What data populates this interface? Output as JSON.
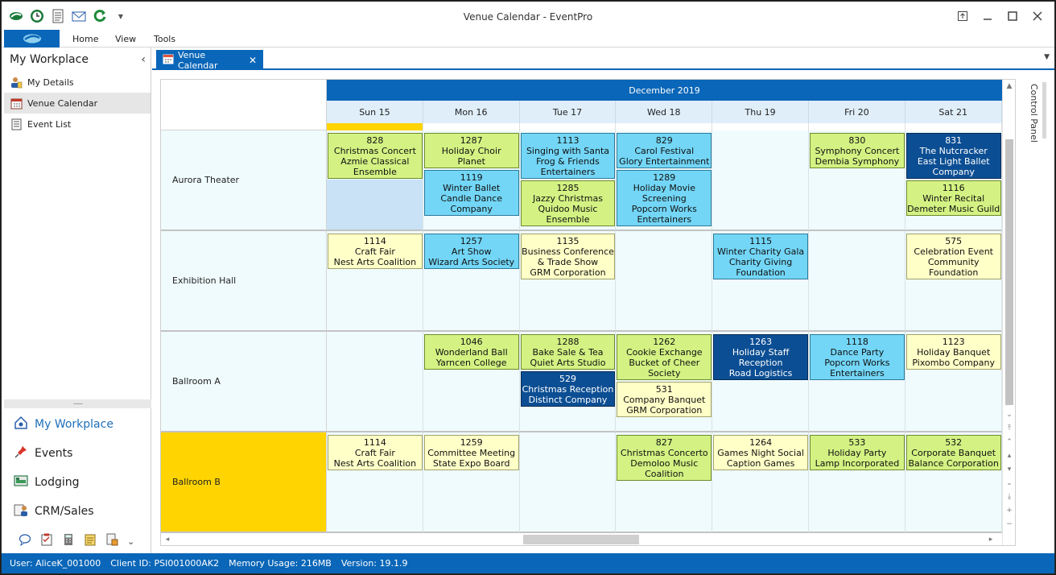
{
  "window": {
    "title": "Venue Calendar - EventPro"
  },
  "ribbon": {
    "tabs": [
      "Home",
      "View",
      "Tools"
    ]
  },
  "sidebar": {
    "title": "My Workplace",
    "items": [
      {
        "label": "My Details",
        "icon": "user-details-icon"
      },
      {
        "label": "Venue Calendar",
        "icon": "calendar-icon"
      },
      {
        "label": "Event List",
        "icon": "document-list-icon"
      }
    ],
    "grip": "......",
    "nav": [
      {
        "label": "My Workplace",
        "icon": "home-icon"
      },
      {
        "label": "Events",
        "icon": "pin-icon"
      },
      {
        "label": "Lodging",
        "icon": "lodging-icon"
      },
      {
        "label": "CRM/Sales",
        "icon": "crm-icon"
      }
    ]
  },
  "doc_tab": {
    "label": "Venue Calendar"
  },
  "calendar": {
    "month": "December 2019",
    "days": [
      "Sun 15",
      "Mon 16",
      "Tue 17",
      "Wed 18",
      "Thu 19",
      "Fri 20",
      "Sat 21"
    ],
    "resources": [
      "Aurora Theater",
      "Exhibition Hall",
      "Ballroom A",
      "Ballroom B"
    ],
    "events": [
      {
        "res": 0,
        "day": 0,
        "slot": 0,
        "span": 2,
        "color": "g",
        "lines": [
          "828",
          "Christmas Concert",
          "Azmie Classical",
          "Ensemble"
        ]
      },
      {
        "res": 0,
        "day": 1,
        "slot": 0,
        "span": 1,
        "color": "g",
        "lines": [
          "1287",
          "Holiday Choir",
          "Planet Entertainment"
        ]
      },
      {
        "res": 0,
        "day": 1,
        "slot": 1,
        "span": 2,
        "color": "c",
        "lines": [
          "1119",
          "Winter Ballet",
          "Candle Dance",
          "Company"
        ]
      },
      {
        "res": 0,
        "day": 2,
        "slot": 0,
        "span": 2,
        "color": "c",
        "lines": [
          "1113",
          "Singing with Santa",
          "Frog & Friends",
          "Entertainers"
        ]
      },
      {
        "res": 0,
        "day": 2,
        "slot": 2,
        "span": 2,
        "color": "g",
        "lines": [
          "1285",
          "Jazzy Christmas",
          "Quidoo Music",
          "Ensemble"
        ]
      },
      {
        "res": 0,
        "day": 3,
        "slot": 0,
        "span": 1,
        "color": "c",
        "lines": [
          "829",
          "Carol Festival",
          "Glory Entertainment"
        ]
      },
      {
        "res": 0,
        "day": 3,
        "slot": 1,
        "span": 3,
        "color": "c",
        "lines": [
          "1289",
          "Holiday Movie",
          "Screening",
          "Popcorn Works",
          "Entertainers"
        ]
      },
      {
        "res": 0,
        "day": 5,
        "slot": 0,
        "span": 1,
        "color": "g",
        "lines": [
          "830",
          "Symphony Concert",
          "Dembia Symphony"
        ]
      },
      {
        "res": 0,
        "day": 6,
        "slot": 0,
        "span": 2,
        "color": "b",
        "lines": [
          "831",
          "The Nutcracker",
          "East Light Ballet",
          "Company"
        ]
      },
      {
        "res": 0,
        "day": 6,
        "slot": 2,
        "span": 1,
        "color": "g",
        "lines": [
          "1116",
          "Winter Recital",
          "Demeter Music Guild"
        ]
      },
      {
        "res": 1,
        "day": 0,
        "slot": 0,
        "span": 1,
        "color": "y",
        "lines": [
          "1114",
          "Craft Fair",
          "Nest Arts Coalition"
        ]
      },
      {
        "res": 1,
        "day": 1,
        "slot": 0,
        "span": 1,
        "color": "c",
        "lines": [
          "1257",
          "Art Show",
          "Wizard Arts Society"
        ]
      },
      {
        "res": 1,
        "day": 2,
        "slot": 0,
        "span": 2,
        "color": "y",
        "lines": [
          "1135",
          "Business Conference",
          "& Trade Show",
          "GRM Corporation"
        ]
      },
      {
        "res": 1,
        "day": 4,
        "slot": 0,
        "span": 2,
        "color": "c",
        "lines": [
          "1115",
          "Winter Charity Gala",
          "Charity Giving",
          "Foundation"
        ]
      },
      {
        "res": 1,
        "day": 6,
        "slot": 0,
        "span": 2,
        "color": "y",
        "lines": [
          "575",
          "Celebration Event",
          "Community",
          "Foundation"
        ]
      },
      {
        "res": 2,
        "day": 1,
        "slot": 0,
        "span": 1,
        "color": "g",
        "lines": [
          "1046",
          "Wonderland Ball",
          "Yarncen College"
        ]
      },
      {
        "res": 2,
        "day": 2,
        "slot": 0,
        "span": 1,
        "color": "g",
        "lines": [
          "1288",
          "Bake Sale & Tea",
          "Quiet Arts Studio"
        ]
      },
      {
        "res": 2,
        "day": 2,
        "slot": 1,
        "span": 1,
        "color": "b",
        "lines": [
          "529",
          "Christmas Reception",
          "Distinct Company"
        ]
      },
      {
        "res": 2,
        "day": 3,
        "slot": 0,
        "span": 2,
        "color": "g",
        "lines": [
          "1262",
          "Cookie Exchange",
          "Bucket of Cheer",
          "Society"
        ]
      },
      {
        "res": 2,
        "day": 3,
        "slot": 2,
        "span": 1,
        "color": "y",
        "lines": [
          "531",
          "Company Banquet",
          "GRM Corporation"
        ]
      },
      {
        "res": 2,
        "day": 4,
        "slot": 0,
        "span": 2,
        "color": "b",
        "lines": [
          "1263",
          "Holiday Staff",
          "Reception",
          "Road Logistics"
        ]
      },
      {
        "res": 2,
        "day": 5,
        "slot": 0,
        "span": 2,
        "color": "c",
        "lines": [
          "1118",
          "Dance Party",
          "Popcorn Works",
          "Entertainers"
        ]
      },
      {
        "res": 2,
        "day": 6,
        "slot": 0,
        "span": 1,
        "color": "y",
        "lines": [
          "1123",
          "Holiday Banquet",
          "Pixombo Company"
        ]
      },
      {
        "res": 3,
        "day": 0,
        "slot": 0,
        "span": 1,
        "color": "y",
        "lines": [
          "1114",
          "Craft Fair",
          "Nest Arts Coalition"
        ]
      },
      {
        "res": 3,
        "day": 1,
        "slot": 0,
        "span": 1,
        "color": "y",
        "lines": [
          "1259",
          "Committee Meeting",
          "State Expo Board"
        ]
      },
      {
        "res": 3,
        "day": 3,
        "slot": 0,
        "span": 2,
        "color": "g",
        "lines": [
          "827",
          "Christmas Concerto",
          "Demoloo Music",
          "Coalition"
        ]
      },
      {
        "res": 3,
        "day": 4,
        "slot": 0,
        "span": 1,
        "color": "y",
        "lines": [
          "1264",
          "Games Night Social",
          "Caption Games"
        ]
      },
      {
        "res": 3,
        "day": 5,
        "slot": 0,
        "span": 1,
        "color": "g",
        "lines": [
          "533",
          "Holiday Party",
          "Lamp Incorporated"
        ]
      },
      {
        "res": 3,
        "day": 6,
        "slot": 0,
        "span": 1,
        "color": "g",
        "lines": [
          "532",
          "Corporate Banquet",
          "Balance Corporation"
        ]
      }
    ]
  },
  "control_panel": {
    "label": "Control Panel"
  },
  "status": {
    "user": "User: AliceK_001000",
    "client": "Client ID: PSI001000AK2",
    "memory": "Memory Usage: 216MB",
    "version": "Version: 19.1.9"
  },
  "colors": {
    "accent": "#0a66b8",
    "selection": "#ffd400"
  }
}
